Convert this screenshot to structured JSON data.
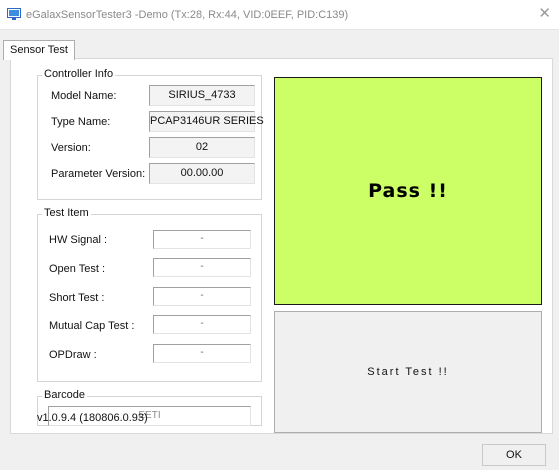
{
  "window": {
    "title": "eGalaxSensorTester3 -Demo (Tx:28, Rx:44, VID:0EEF, PID:C139)",
    "close_glyph": "✕"
  },
  "tabs": [
    {
      "label": "Sensor Test"
    }
  ],
  "controller_info": {
    "title": "Controller Info",
    "rows": [
      {
        "label": "Model Name:",
        "value": "SIRIUS_4733"
      },
      {
        "label": "Type Name:",
        "value": "PCAP3146UR SERIES"
      },
      {
        "label": "Version:",
        "value": "02"
      },
      {
        "label": "Parameter Version:",
        "value": "00.00.00"
      }
    ]
  },
  "test_item": {
    "title": "Test Item",
    "rows": [
      {
        "label": "HW Signal :",
        "value": "-"
      },
      {
        "label": "Open Test :",
        "value": "-"
      },
      {
        "label": "Short Test :",
        "value": "-"
      },
      {
        "label": "Mutual Cap Test :",
        "value": "-"
      },
      {
        "label": "OPDraw :",
        "value": "-"
      }
    ]
  },
  "barcode": {
    "title": "Barcode",
    "value": "EETI"
  },
  "result": {
    "text": "Pass !!",
    "color": "#ccff66"
  },
  "start_button": {
    "label": "Start  Test  !!"
  },
  "version_text": "v1.0.9.4 (180806.0.93)",
  "ok_button": {
    "label": "OK"
  }
}
